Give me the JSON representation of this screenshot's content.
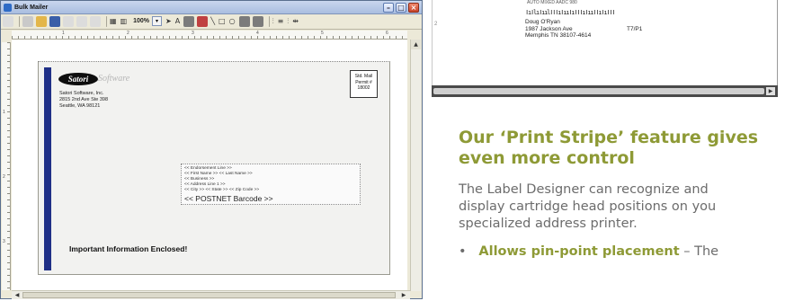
{
  "window": {
    "title": "Bulk Mailer",
    "controls": [
      "minimize-icon",
      "maximize-icon",
      "close-icon"
    ]
  },
  "toolbar": {
    "zoom": "100%",
    "icons": [
      "print-preview-icon",
      "print-icon",
      "open-folder-icon",
      "save-icon",
      "cut-icon",
      "copy-icon",
      "paste-icon",
      "grid-icon",
      "columns-icon",
      "pointer-icon",
      "text-icon",
      "image-icon",
      "barcode-icon",
      "line-icon",
      "rectangle-icon",
      "ellipse-icon",
      "align-left-icon",
      "align-center-icon",
      "align-right-icon"
    ]
  },
  "ruler": {
    "marks": [
      "1",
      "2",
      "3",
      "4",
      "5",
      "6"
    ],
    "vmarks": [
      "1",
      "2",
      "3"
    ]
  },
  "envelope": {
    "logo_bold": "Satori",
    "logo_light": "Software",
    "return_name": "Satori Software, Inc.",
    "return_street": "2815 2nd Ave Ste 398",
    "return_city": "Seattle, WA 98121",
    "stamp_line1": "Std. Mail",
    "stamp_line2": "Permit #",
    "stamp_line3": "18002",
    "address_lines": [
      "<< Endorsement Line >>",
      "<< First Name >> << Last Name >>",
      "<< Business >>",
      "<< Address Line 1 >>",
      "<< City >> << State >> << Zip Code >>"
    ],
    "barcode_placeholder": "<< POSTNET Barcode >>",
    "important": "Important Information Enclosed!"
  },
  "preview": {
    "row_number": "2",
    "top_line": "AUTO    MIXED AADC 980",
    "barcode": "ǀıǀlıǀıılǀǀǀıǀııǀıǀǀǀıǀııǀǀıǀıǀǀǀ",
    "recipient_name": "Doug O'Ryan",
    "recipient_street": "1987 Jackson Ave",
    "recipient_city": "Memphis TN 38107-4614",
    "route": "T7/P1"
  },
  "copy": {
    "heading_line1": "Our ‘Print Stripe’ feature gives",
    "heading_line2": "even more control",
    "body_line1": "The Label Designer can recognize and",
    "body_line2": "display cartridge head positions on you",
    "body_line3": "specialized address printer.",
    "bullet_bold": "Allows pin-point placement",
    "bullet_rest": " – The"
  },
  "colors": {
    "heading": "#8e9a36",
    "body": "#6c6c6c",
    "envelope_bar": "#1f2f86"
  }
}
